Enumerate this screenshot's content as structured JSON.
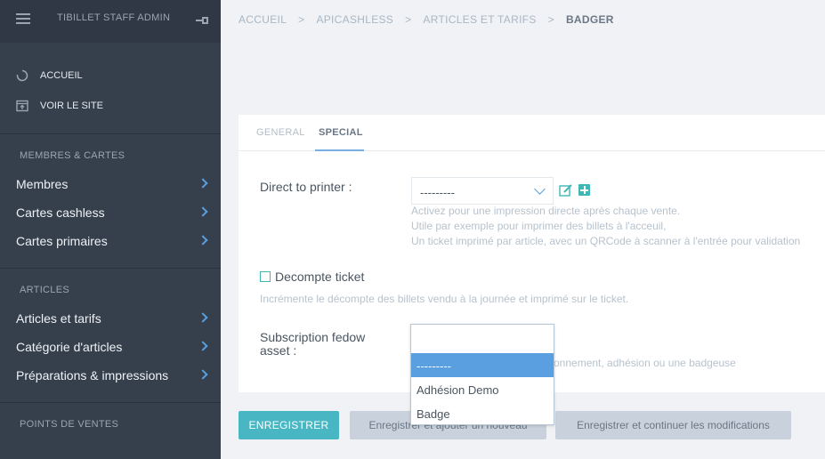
{
  "sidebar": {
    "app_title": "TIBILLET STAFF ADMIN",
    "links": [
      {
        "label": "ACCUEIL",
        "icon": "refresh-icon"
      },
      {
        "label": "VOIR LE SITE",
        "icon": "external-site-icon"
      }
    ],
    "sections": [
      {
        "title": "MEMBRES & CARTES",
        "items": [
          "Membres",
          "Cartes cashless",
          "Cartes primaires"
        ]
      },
      {
        "title": "ARTICLES",
        "items": [
          "Articles et tarifs",
          "Catégorie d'articles",
          "Préparations & impressions"
        ]
      },
      {
        "title": "POINTS DE VENTES",
        "items": []
      }
    ]
  },
  "breadcrumb": [
    "ACCUEIL",
    "APICASHLESS",
    "ARTICLES ET TARIFS",
    "BADGER"
  ],
  "tabs": {
    "general": "GENERAL",
    "special": "SPECIAL"
  },
  "form": {
    "direct_printer": {
      "label": "Direct to printer :",
      "value": "---------",
      "help": [
        "Activez pour une impression directe après chaque vente.",
        "Utile par exemple pour imprimer des billets à l'acceuil,",
        "Un ticket imprimé par article, avec un QRCode à scanner à l'entrée pour validation"
      ]
    },
    "decompte": {
      "label": "Decompte ticket",
      "help": "Incrémente le décompte des billets vendu à la journée et imprimé sur le ticket."
    },
    "subscription": {
      "label_line1": "Subscription fedow",
      "label_line2": "asset :",
      "help_partial": "onnement, adhésion ou une badgeuse",
      "options": [
        "---------",
        "Adhésion Demo",
        "Badge"
      ]
    }
  },
  "buttons": {
    "save": "ENREGISTRER",
    "save_add": "Enregistrer et ajouter un nouveau",
    "save_continue": "Enregistrer et continuer les modifications"
  },
  "colors": {
    "sidebar_bg": "#36404c",
    "accent": "#48b7c3",
    "select_highlight": "#5a9fe0"
  }
}
